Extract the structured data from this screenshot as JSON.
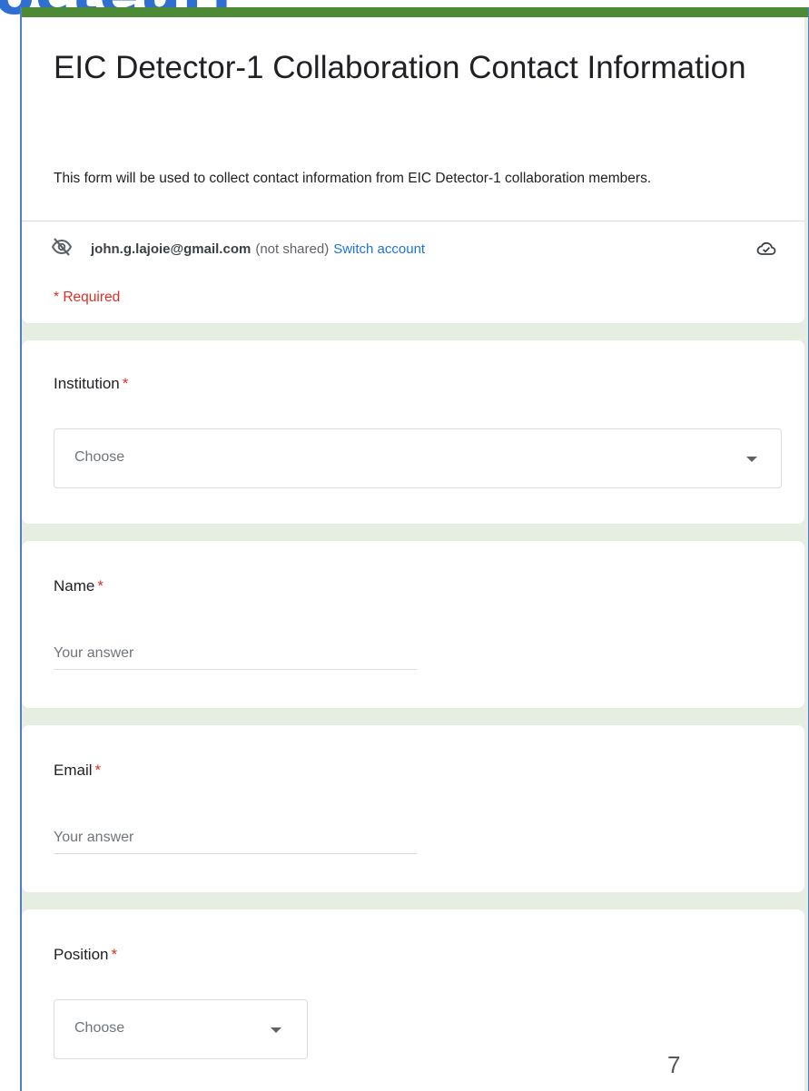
{
  "slide": {
    "cut_title": "octeurj",
    "page_number": "7"
  },
  "form": {
    "title": "EIC Detector-1 Collaboration Contact Information",
    "description": "This form will be used to collect contact information from EIC Detector-1 collaboration members.",
    "account_email": "john.g.lajoie@gmail.com",
    "not_shared": "(not shared)",
    "switch_account": "Switch account",
    "required_note": "* Required",
    "accent_color": "#4c8a36",
    "required_color": "#d93025",
    "link_color": "#1a73e8"
  },
  "questions": {
    "institution": {
      "label": "Institution",
      "required_mark": "*",
      "placeholder": "Choose"
    },
    "name": {
      "label": "Name",
      "required_mark": "*",
      "placeholder": "Your answer"
    },
    "email": {
      "label": "Email",
      "required_mark": "*",
      "placeholder": "Your answer"
    },
    "position": {
      "label": "Position",
      "required_mark": "*",
      "placeholder": "Choose"
    }
  },
  "icons": {
    "visibility": "eye-off-icon",
    "cloud": "cloud-check-icon",
    "dropdown": "caret-down-icon"
  }
}
